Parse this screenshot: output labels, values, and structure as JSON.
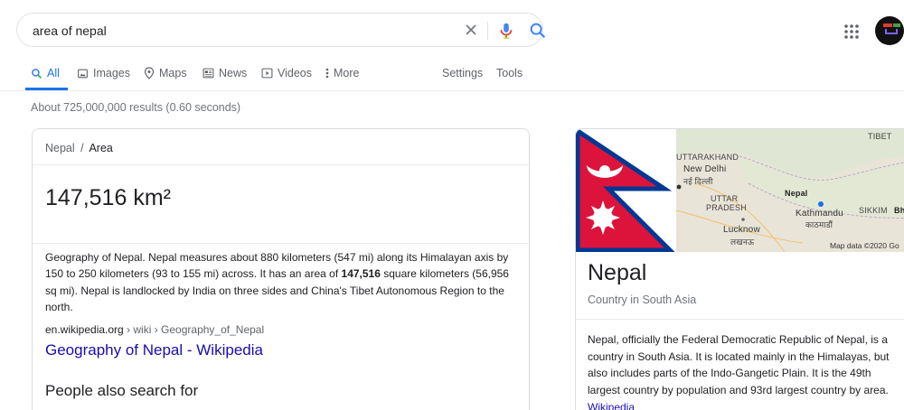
{
  "search": {
    "query": "area of nepal"
  },
  "tabs": [
    {
      "label": "All"
    },
    {
      "label": "Images"
    },
    {
      "label": "Maps"
    },
    {
      "label": "News"
    },
    {
      "label": "Videos"
    },
    {
      "label": "More"
    },
    {
      "label": "Settings"
    },
    {
      "label": "Tools"
    }
  ],
  "results_stats": "About 725,000,000 results (0.60 seconds)",
  "answer_card": {
    "breadcrumb_root": "Nepal",
    "breadcrumb_sep": "/",
    "breadcrumb_current": "Area",
    "answer": "147,516 km²",
    "description_before": "Geography of Nepal. Nepal measures about 880 kilometers (547 mi) along its Himalayan axis by 150 to 250 kilometers (93 to 155 mi) across. It has an area of ",
    "description_bold": "147,516",
    "description_after": " square kilometers (56,956 sq mi). Nepal is landlocked by India on three sides and China's Tibet Autonomous Region to the north.",
    "source_host": "en.wikipedia.org",
    "source_path": " › wiki › Geography_of_Nepal",
    "source_title": "Geography of Nepal - Wikipedia",
    "people_also_search": "People also search for"
  },
  "knowledge_panel": {
    "title": "Nepal",
    "subtitle": "Country in South Asia",
    "description": "Nepal, officially the Federal Democratic Republic of Nepal, is a country in South Asia. It is located mainly in the Himalayas, but also includes parts of the Indo-Gangetic Plain. It is the 49th largest country by population and 93rd largest country by area. ",
    "source_link": "Wikipedia",
    "map_labels": {
      "tibet": "TIBET",
      "uttarakhand": "UTTARAKHAND",
      "new_delhi": "New Delhi",
      "new_delhi_hi": "नई दिल्ली",
      "uttar_pradesh_1": "UTTAR",
      "uttar_pradesh_2": "PRADESH",
      "nepal": "Nepal",
      "kathmandu": "Kathmandu",
      "kathmandu_ne": "काठमाडौं",
      "sikkim": "SIKKIM",
      "bhutan": "Bh",
      "lucknow": "Lucknow",
      "lucknow_hi": "लखनऊ",
      "attribution": "Map data ©2020 Go"
    }
  },
  "colors": {
    "flag_red": "#dc143c",
    "flag_blue": "#003893",
    "link": "#1a0dab",
    "accent": "#1a73e8"
  }
}
